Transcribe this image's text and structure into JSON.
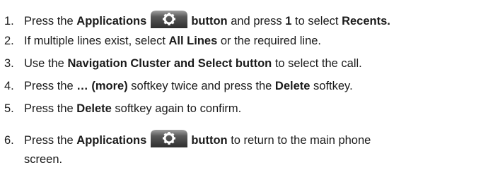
{
  "steps": [
    {
      "num": "1.",
      "t1": "Press the ",
      "b1": "Applications",
      "t2": " ",
      "icon": "applications-gear-button-icon",
      "b2": "button",
      "t3": " and press ",
      "b3": "1",
      "t4": " to select ",
      "b4": "Recents."
    },
    {
      "num": "2.",
      "t1": "If multiple lines exist, select ",
      "b1": "All Lines",
      "t2": " or the required line."
    },
    {
      "num": "3.",
      "t1": "Use the ",
      "b1": "Navigation Cluster and Select button",
      "t2": " to select the call."
    },
    {
      "num": "4.",
      "t1": "Press the ",
      "b1": "… (more)",
      "t2": " softkey twice and press the ",
      "b2": "Delete",
      "t3": " softkey."
    },
    {
      "num": "5.",
      "t1": "Press the ",
      "b1": "Delete",
      "t2": " softkey again to confirm."
    },
    {
      "num": "6.",
      "t1": "Press the ",
      "b1": "Applications",
      "icon": "applications-gear-button-icon",
      "b2": "button",
      "t2": " to return to the main phone",
      "cont": "screen."
    }
  ],
  "colors": {
    "text": "#1a1a1a",
    "button_dark": "#3a3a3a",
    "button_light": "#9a9a9a",
    "gear": "#ffffff"
  }
}
